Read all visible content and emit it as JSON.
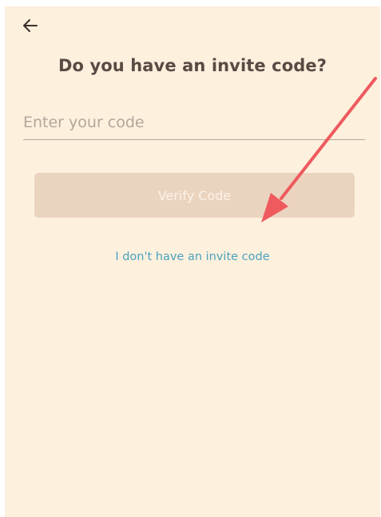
{
  "header": {
    "back_icon": "arrow-left-icon",
    "title": "Do you have an invite code?"
  },
  "form": {
    "code_placeholder": "Enter your code",
    "code_value": "",
    "verify_label": "Verify Code",
    "verify_enabled": false,
    "no_code_link": "I don't have an invite code"
  },
  "colors": {
    "background": "#fdf0dd",
    "title_text": "#5a4a44",
    "button_disabled": "#ebd4bf",
    "link": "#4aa2bf",
    "annotation_arrow": "#ee5a5e"
  }
}
